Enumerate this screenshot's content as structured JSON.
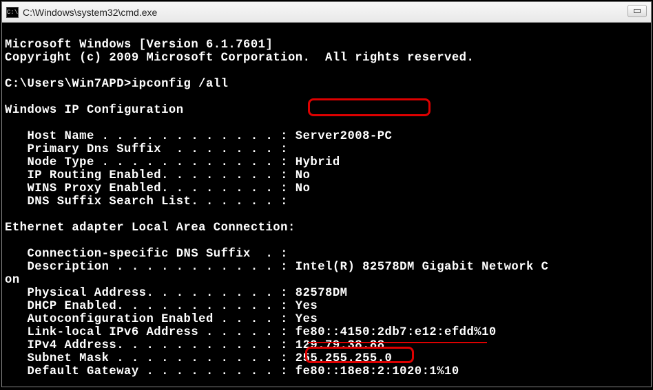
{
  "window": {
    "title": "C:\\Windows\\system32\\cmd.exe",
    "icon_label": "C:\\"
  },
  "header": {
    "version_line": "Microsoft Windows [Version 6.1.7601]",
    "copyright_line": "Copyright (c) 2009 Microsoft Corporation.  All rights reserved."
  },
  "prompt": {
    "path": "C:\\Users\\Win7APD>",
    "command": "ipconfig /all"
  },
  "sections": {
    "ipconfig_header": "Windows IP Configuration",
    "adapter_header": "Ethernet adapter Local Area Connection:"
  },
  "ipcfg": {
    "host_name_label": "   Host Name . . . . . . . . . . . . : ",
    "host_name_value": "Server2008-PC",
    "primary_dns_label": "   Primary Dns Suffix  . . . . . . . :",
    "primary_dns_value": "",
    "node_type_label": "   Node Type . . . . . . . . . . . . : ",
    "node_type_value": "Hybrid",
    "ip_routing_label": "   IP Routing Enabled. . . . . . . . : ",
    "ip_routing_value": "No",
    "wins_proxy_label": "   WINS Proxy Enabled. . . . . . . . : ",
    "wins_proxy_value": "No",
    "dns_suffix_list_label": "   DNS Suffix Search List. . . . . . :",
    "dns_suffix_list_value": ""
  },
  "adapter": {
    "conn_suffix_label": "   Connection-specific DNS Suffix  . :",
    "conn_suffix_value": "",
    "description_label": "   Description . . . . . . . . . . . : ",
    "description_value": "Intel(R) 82578DM Gigabit Network C",
    "description_wrap": "on",
    "phys_addr_label": "   Physical Address. . . . . . . . . : ",
    "phys_addr_value": "82578DM",
    "dhcp_label": "   DHCP Enabled. . . . . . . . . . . : ",
    "dhcp_value": "Yes",
    "autoconf_label": "   Autoconfiguration Enabled . . . . : ",
    "autoconf_value": "Yes",
    "linklocal_label": "   Link-local IPv6 Address . . . . . : ",
    "linklocal_value": "fe80::4150:2db7:e12:efdd%10",
    "ipv4_label": "   IPv4 Address. . . . . . . . . . . : ",
    "ipv4_value": "129.79.38.88",
    "subnet_label": "   Subnet Mask . . . . . . . . . . . : ",
    "subnet_value": "255.255.255.0",
    "gateway_label": "   Default Gateway . . . . . . . . . : ",
    "gateway_value": "fe80::18e8:2:1020:1%10"
  }
}
